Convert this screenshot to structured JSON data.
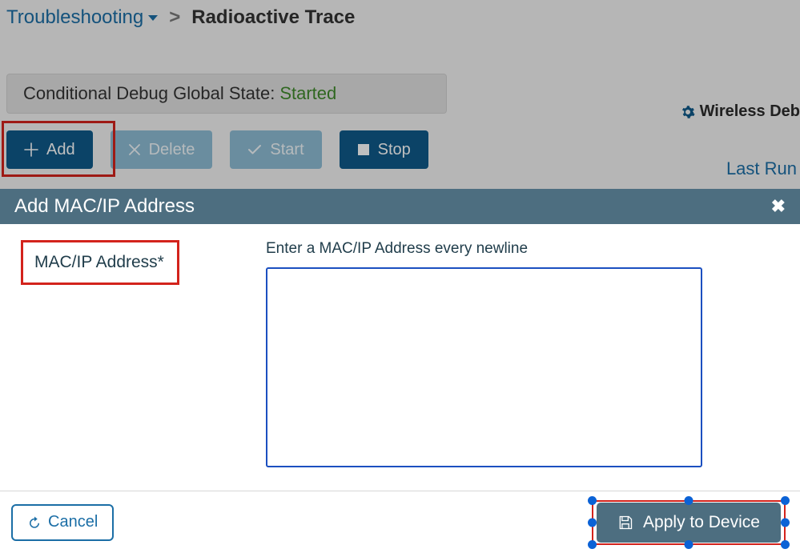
{
  "breadcrumb": {
    "root": "Troubleshooting",
    "separator": ">",
    "current": "Radioactive Trace"
  },
  "status": {
    "label": "Conditional Debug Global State:",
    "value": "Started"
  },
  "toolbar": {
    "add": "Add",
    "delete": "Delete",
    "start": "Start",
    "stop": "Stop"
  },
  "sidelinks": {
    "wireless_debug": "Wireless Deb",
    "last_run": "Last Run"
  },
  "modal": {
    "title": "Add MAC/IP Address",
    "field_label": "MAC/IP Address*",
    "hint": "Enter a MAC/IP Address every newline",
    "textarea_value": "",
    "cancel": "Cancel",
    "apply": "Apply to Device"
  }
}
